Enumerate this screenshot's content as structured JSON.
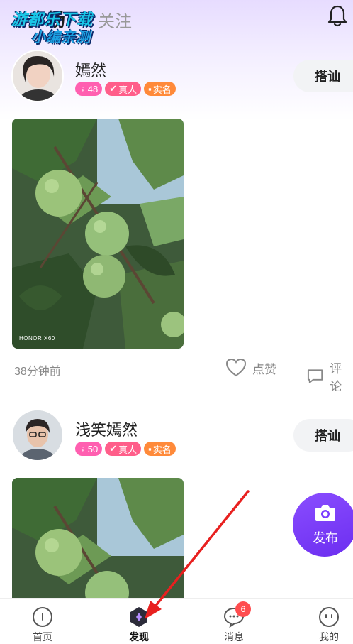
{
  "header": {
    "tab_active": "广场",
    "tab_inactive": "关注",
    "watermark_line1": "游都乐下载",
    "watermark_line2": "小编亲测",
    "bell_icon": "bell-icon"
  },
  "posts": [
    {
      "name": "嫣然",
      "age": "48",
      "badge_real": "真人",
      "badge_verified": "实名",
      "chat_label": "搭讪",
      "photo_caption": "HONOR X60",
      "time": "38分钟前",
      "like_label": "点赞",
      "comment_label": "评论"
    },
    {
      "name": "浅笑嫣然",
      "age": "50",
      "badge_real": "真人",
      "badge_verified": "实名",
      "chat_label": "搭讪"
    }
  ],
  "fab": {
    "label": "发布"
  },
  "bottom_nav": {
    "items": [
      {
        "label": "首页",
        "icon": "home-icon"
      },
      {
        "label": "发现",
        "icon": "discover-icon"
      },
      {
        "label": "消息",
        "icon": "message-icon",
        "badge": "6"
      },
      {
        "label": "我的",
        "icon": "profile-icon"
      }
    ]
  },
  "colors": {
    "accent": "#7a3cff",
    "badge_pink": "#ff5fb0",
    "badge_orange": "#ff8a3a",
    "annotation_red": "#e8201f"
  }
}
